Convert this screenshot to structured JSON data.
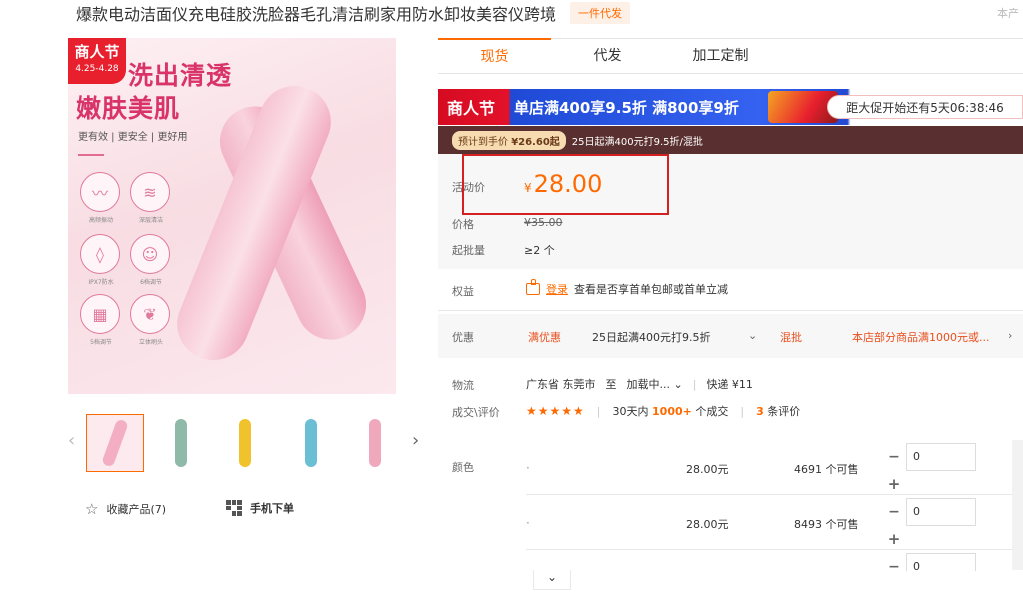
{
  "header": {
    "title": "爆款电动洁面仪充电硅胶洗脸器毛孔清洁刷家用防水卸妆美容仪跨境",
    "dropship_tag": "一件代发",
    "corner_text": "本产"
  },
  "gallery": {
    "festival_badge": "商人节",
    "festival_dates": "4.25-4.28",
    "hero_line1": "洗出清透",
    "hero_line2": "嫩肤美肌",
    "hero_sub": "更有效 | 更安全 | 更好用",
    "features": [
      "高频振动",
      "深层清洁",
      "IPX7防水",
      "6档调节",
      "5档调节",
      "立体刷头"
    ],
    "thumb_colors": [
      "#f3aec3",
      "#8fb9a8",
      "#f0c22b",
      "#6bbfd4",
      "#f0a8bd"
    ]
  },
  "actions": {
    "favorite_label": "收藏产品(7)",
    "mobile_label": "手机下单"
  },
  "tabs": [
    "现货",
    "代发",
    "加工定制"
  ],
  "promo": {
    "festival": "商人节",
    "deal": "单店满400享9.5折  满800享9折",
    "countdown": "距大促开始还有5天06:38:46",
    "estimate_label": "预计到手价",
    "estimate_value": "¥26.60起",
    "estimate_desc": "25日起满400元打9.5折/混批"
  },
  "pricing": {
    "activity_label": "活动价",
    "currency": "¥",
    "price": "28.00",
    "orig_label": "价格",
    "orig_price": "¥35.00",
    "moq_label": "起批量",
    "moq": "≥2 个"
  },
  "rights": {
    "label": "权益",
    "link": "登录",
    "desc": "查看是否享首单包邮或首单立减"
  },
  "discount": {
    "label": "优惠",
    "coupon": "满优惠",
    "coupon_desc": "25日起满400元打9.5折",
    "mix": "混批",
    "mix_desc": "本店部分商品满1000元或..."
  },
  "logistics": {
    "label": "物流",
    "from": "广东省 东莞市",
    "to_word": "至",
    "to": "加载中...",
    "express": "快递 ¥11"
  },
  "trade": {
    "label": "成交\\评价",
    "stars": "★★★★★",
    "sold_prefix": "30天内",
    "sold_count": "1000+",
    "sold_suffix": "个成交",
    "review_count": "3",
    "review_suffix": "条评价"
  },
  "sku": {
    "label": "颜色",
    "rows": [
      {
        "price": "28.00元",
        "stock": "4691 个可售",
        "qty": "0"
      },
      {
        "price": "28.00元",
        "stock": "8493 个可售",
        "qty": "0"
      },
      {
        "price": "",
        "stock": "",
        "qty": "0"
      }
    ]
  }
}
